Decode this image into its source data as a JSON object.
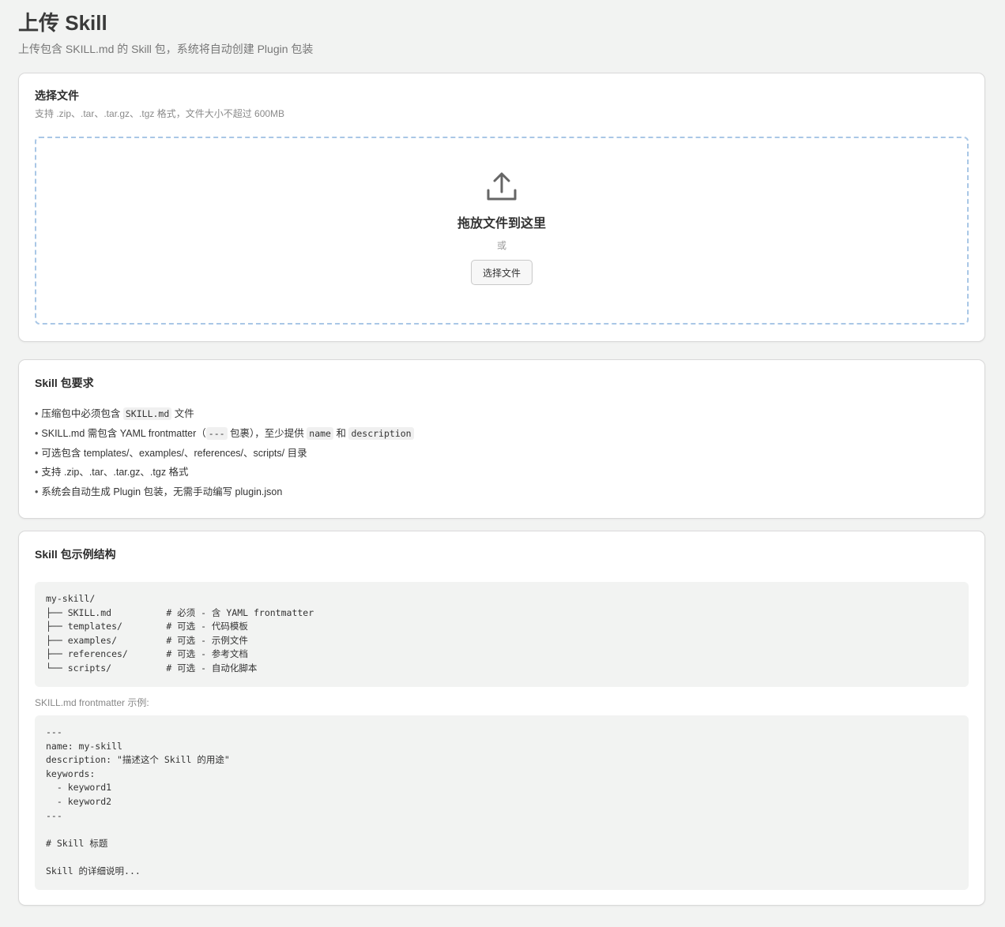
{
  "header": {
    "title": "上传 Skill",
    "subtitle": "上传包含 SKILL.md 的 Skill 包，系统将自动创建 Plugin 包装"
  },
  "upload": {
    "title": "选择文件",
    "description": "支持 .zip、.tar、.tar.gz、.tgz 格式，文件大小不超过 600MB",
    "drop_text": "拖放文件到这里",
    "or_text": "或",
    "button_label": "选择文件",
    "icon": "upload-icon",
    "dropzone_border_color": "#a9c7e6"
  },
  "requirements": {
    "title": "Skill 包要求",
    "items": [
      {
        "t1": "压缩包中必须包含 ",
        "c1": "SKILL.md",
        "t2": " 文件"
      },
      {
        "t1": "SKILL.md 需包含 YAML frontmatter（",
        "c1": "---",
        "t2": " 包裹），至少提供 ",
        "c2": "name",
        "t3": " 和 ",
        "c3": "description"
      },
      {
        "t1": "可选包含 templates/、examples/、references/、scripts/ 目录"
      },
      {
        "t1": "支持 .zip、.tar、.tar.gz、.tgz 格式"
      },
      {
        "t1": "系统会自动生成 Plugin 包装，无需手动编写 plugin.json"
      }
    ]
  },
  "example": {
    "title": "Skill 包示例结构",
    "tree_code": "my-skill/\n├── SKILL.md          # 必须 - 含 YAML frontmatter\n├── templates/        # 可选 - 代码模板\n├── examples/         # 可选 - 示例文件\n├── references/       # 可选 - 参考文档\n└── scripts/          # 可选 - 自动化脚本",
    "frontmatter_label": "SKILL.md frontmatter 示例:",
    "frontmatter_code": "---\nname: my-skill\ndescription: \"描述这个 Skill 的用途\"\nkeywords:\n  - keyword1\n  - keyword2\n---\n\n# Skill 标题\n\nSkill 的详细说明..."
  }
}
